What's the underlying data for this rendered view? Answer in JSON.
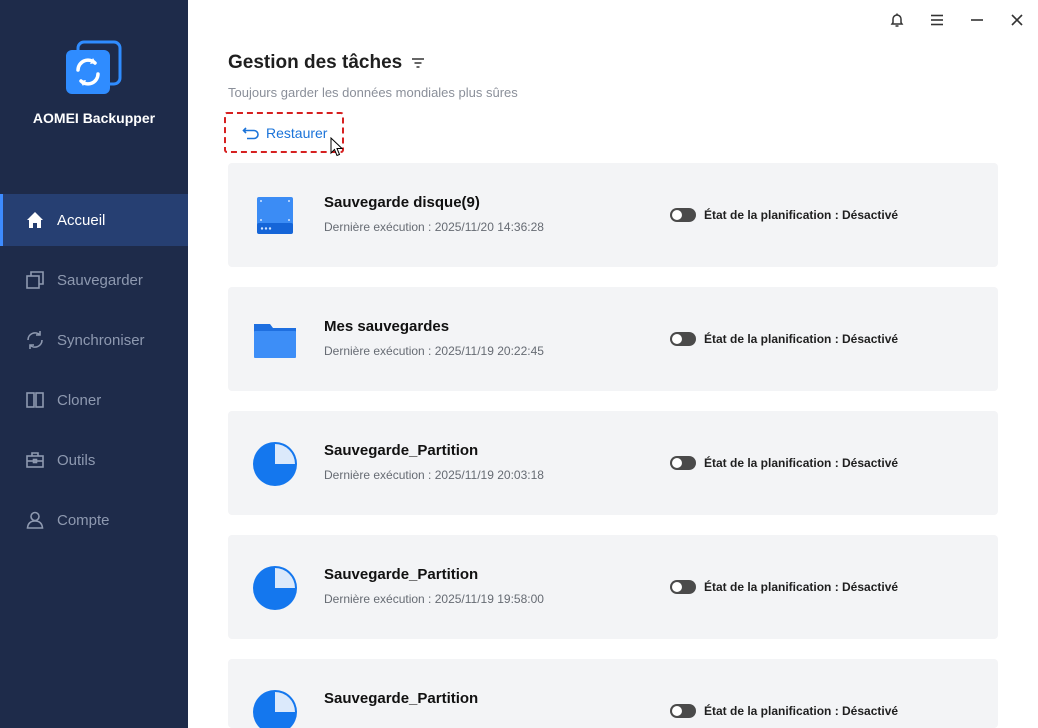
{
  "app": {
    "name": "AOMEI Backupper"
  },
  "sidebar": {
    "items": [
      {
        "label": "Accueil",
        "icon": "home-icon",
        "active": true
      },
      {
        "label": "Sauvegarder",
        "icon": "backup-icon",
        "active": false
      },
      {
        "label": "Synchroniser",
        "icon": "sync-icon",
        "active": false
      },
      {
        "label": "Cloner",
        "icon": "clone-icon",
        "active": false
      },
      {
        "label": "Outils",
        "icon": "tools-icon",
        "active": false
      },
      {
        "label": "Compte",
        "icon": "user-icon",
        "active": false
      }
    ]
  },
  "window": {
    "buttons": [
      "bell-icon",
      "menu-icon",
      "minimize-icon",
      "close-icon"
    ]
  },
  "header": {
    "title": "Gestion des tâches",
    "subtitle": "Toujours garder les données mondiales plus sûres",
    "restore_label": "Restaurer"
  },
  "tasks": [
    {
      "name": "Sauvegarde disque(9)",
      "last_run": "Dernière exécution : 2025/11/20 14:36:28",
      "schedule": "État de la planification : Désactivé",
      "icon": "disk-icon"
    },
    {
      "name": "Mes sauvegardes",
      "last_run": "Dernière exécution : 2025/11/19 20:22:45",
      "schedule": "État de la planification : Désactivé",
      "icon": "folder-icon"
    },
    {
      "name": "Sauvegarde_Partition",
      "last_run": "Dernière exécution : 2025/11/19 20:03:18",
      "schedule": "État de la planification : Désactivé",
      "icon": "partition-icon"
    },
    {
      "name": "Sauvegarde_Partition",
      "last_run": "Dernière exécution : 2025/11/19 19:58:00",
      "schedule": "État de la planification : Désactivé",
      "icon": "partition-icon"
    },
    {
      "name": "Sauvegarde_Partition",
      "last_run": "",
      "schedule": "État de la planification : Désactivé",
      "icon": "partition-icon"
    }
  ],
  "colors": {
    "sidebar_bg": "#1e2b4a",
    "sidebar_active": "#263f72",
    "accent": "#1a73d9",
    "highlight_border": "#d62020",
    "card_bg": "#f3f4f6"
  }
}
